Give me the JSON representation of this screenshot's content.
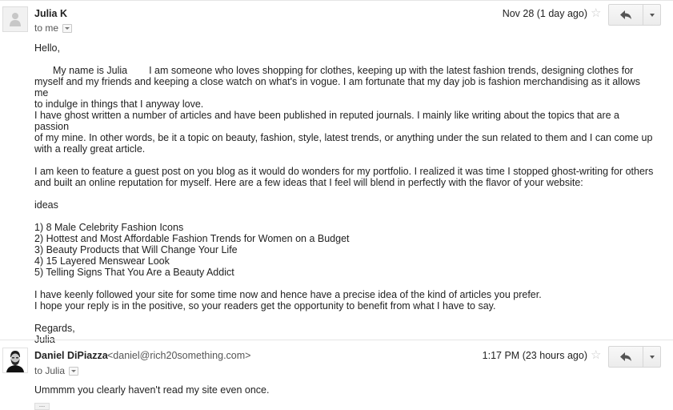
{
  "message1": {
    "sender": "Julia K",
    "recipient_label": "to me",
    "date": "Nov 28 (1 day ago)",
    "greeting": "Hello,",
    "intro_line1_start": "My name is Julia",
    "intro_line1_rest": "I am someone who loves shopping for clothes, keeping up with the latest fashion trends, designing clothes for",
    "intro_line2": "myself and my friends and keeping a close watch on what's in vogue. I am fortunate that my day job is fashion merchandising as it allows me",
    "intro_line3": "to indulge in things that I anyway love.",
    "para2_line1": "I have ghost written a number of articles and have been published in reputed journals. I mainly like writing about the topics that are a passion",
    "para2_line2": "of my mine. In other words, be it a topic on beauty, fashion, style, latest trends, or anything under the sun related to them and I can come up",
    "para2_line3": "with a really great article.",
    "para3_line1": "I am keen to feature a guest post on you blog as it would do wonders for my portfolio. I realized it was time I stopped ghost-writing for others",
    "para3_line2": "and built an online reputation for myself. Here are a few ideas that I feel will blend in perfectly with the flavor of your website:",
    "ideas_heading": "ideas",
    "ideas": [
      "1) 8 Male Celebrity Fashion Icons",
      "2) Hottest and Most Affordable Fashion Trends for Women on a Budget",
      "3) Beauty Products that Will Change Your Life",
      "4) 15 Layered Menswear Look",
      "5) Telling Signs That You Are a Beauty Addict"
    ],
    "closing_line1": "I have keenly followed your site for some time now and hence have a precise idea of the kind of articles you prefer.",
    "closing_line2": "I hope your reply is in the positive, so your readers get the opportunity to benefit from what I have to say.",
    "signoff": "Regards,",
    "signature": "Julia"
  },
  "message2": {
    "sender": "Daniel DiPiazza",
    "sender_email": "<daniel@rich20something.com>",
    "recipient_label": "to Julia",
    "date": "1:17 PM (23 hours ago)",
    "body": "Ummmm you clearly haven't read my site even once.",
    "trimmed_indicator": "..."
  },
  "icons": {
    "star": "☆",
    "reply": "reply-arrow-icon",
    "more": "chevron-down-icon"
  },
  "colors": {
    "text": "#222222",
    "muted": "#555555",
    "star": "#c9c9c9",
    "button_border": "#d6d6d6"
  }
}
